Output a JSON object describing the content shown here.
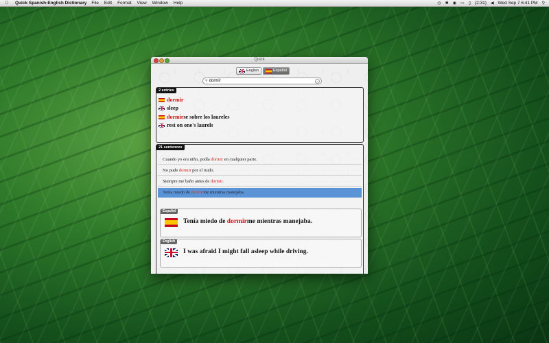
{
  "menubar": {
    "apple_icon": "apple-icon",
    "app_name": "Quick Spanish-English Dictionary",
    "menus": [
      "File",
      "Edit",
      "Format",
      "View",
      "Window",
      "Help"
    ],
    "battery": "(2:31)",
    "clock": "Wed Sep 7  6:41 PM"
  },
  "window": {
    "title": "Quick",
    "lang_buttons": [
      {
        "label": "English",
        "flag": "uk-flag-icon"
      },
      {
        "label": "Español",
        "flag": "spain-flag-icon"
      }
    ],
    "search": {
      "value": "dormir"
    },
    "entries": {
      "badge": "2 entries",
      "items": [
        {
          "flag": "spain-flag-icon",
          "pre": "",
          "hl": "dormir",
          "post": ""
        },
        {
          "flag": "uk-flag-icon",
          "pre": "sleep",
          "hl": "",
          "post": ""
        },
        {
          "flag": "spain-flag-icon",
          "pre": "",
          "hl": "dormir",
          "post": "se sobre los laureles"
        },
        {
          "flag": "uk-flag-icon",
          "pre": "rest on one's laurels",
          "hl": "",
          "post": ""
        }
      ]
    },
    "sentences": {
      "badge": "21 sentences",
      "items": [
        {
          "pre": "Cuando yo era niño, podía ",
          "hl": "dormir",
          "post": " en cualquier parte."
        },
        {
          "pre": "No pude ",
          "hl": "dormir",
          "post": " por el ruido."
        },
        {
          "pre": "Siempre me baño antes de ",
          "hl": "dormir",
          "post": "."
        },
        {
          "pre": "Tenía miedo de ",
          "hl": "dormir",
          "post": "me mientras manejaba."
        }
      ],
      "spanish_label": "Español",
      "spanish_pre": "Tenía miedo de ",
      "spanish_hl": "dormir",
      "spanish_post": "me mientras manejaba.",
      "english_label": "English",
      "english_text": "I was afraid I might fall asleep while driving."
    }
  },
  "colors": {
    "highlight": "#d21010",
    "selection": "#5a93d6"
  }
}
